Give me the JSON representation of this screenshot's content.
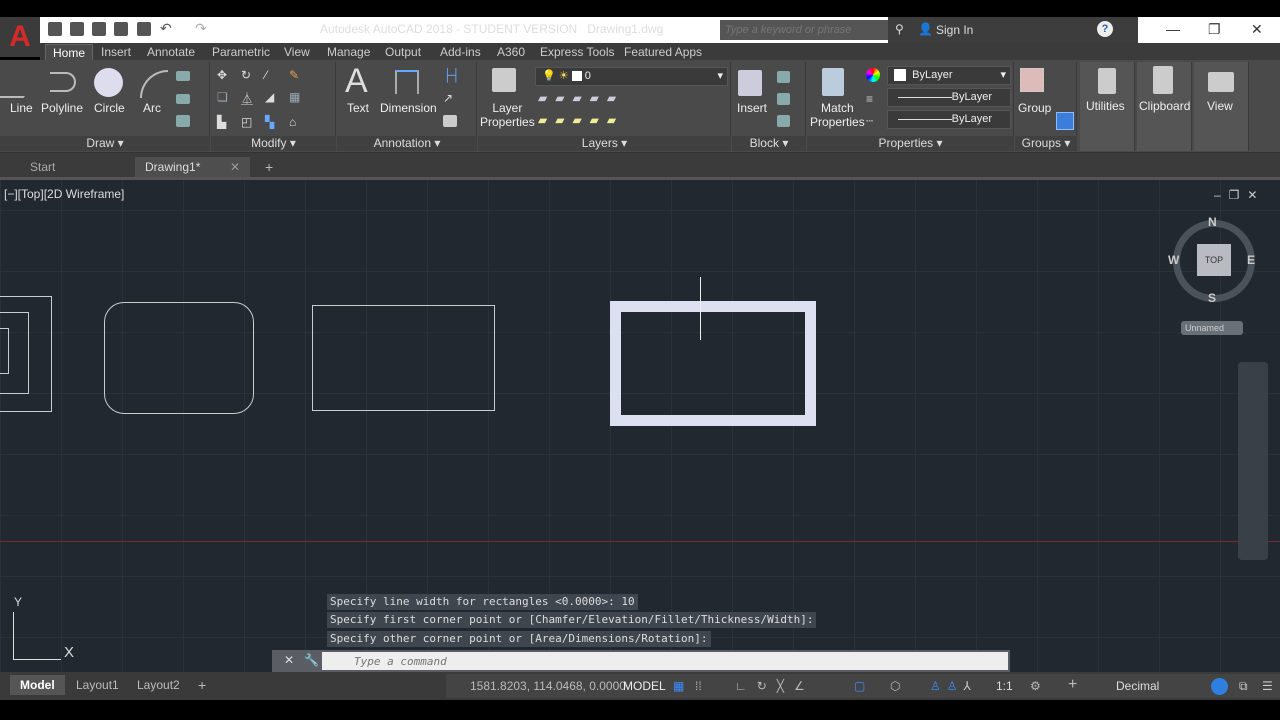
{
  "app": {
    "title": "Autodesk AutoCAD 2018 - STUDENT VERSION",
    "file": "Drawing1.dwg",
    "logo": "A"
  },
  "search": {
    "placeholder": "Type a keyword or phrase"
  },
  "account": {
    "sign_in": "Sign In"
  },
  "ribbon_tabs": [
    "Home",
    "Insert",
    "Annotate",
    "Parametric",
    "View",
    "Manage",
    "Output",
    "Add-ins",
    "A360",
    "Express Tools",
    "Featured Apps"
  ],
  "draw": {
    "title": "Draw",
    "line": "Line",
    "polyline": "Polyline",
    "circle": "Circle",
    "arc": "Arc"
  },
  "modify": {
    "title": "Modify"
  },
  "annotation": {
    "title": "Annotation",
    "text": "Text",
    "dimension": "Dimension"
  },
  "layers": {
    "title": "Layers",
    "layer_properties_1": "Layer",
    "layer_properties_2": "Properties",
    "current_layer": "0"
  },
  "block": {
    "title": "Block",
    "insert": "Insert"
  },
  "properties": {
    "title": "Properties",
    "match_1": "Match",
    "match_2": "Properties",
    "color": "ByLayer",
    "linetype": "ByLayer",
    "lineweight": "ByLayer"
  },
  "groups": {
    "title": "Groups",
    "group": "Group"
  },
  "utilities": "Utilities",
  "clipboard": "Clipboard",
  "view": "View",
  "file_tabs": {
    "start": "Start",
    "drawing": "Drawing1*"
  },
  "viewport": {
    "label": "[−][Top][2D Wireframe]",
    "compass": {
      "n": "N",
      "s": "S",
      "e": "E",
      "w": "W",
      "top": "TOP"
    },
    "ucs_name": "Unnamed",
    "ucs_x": "X",
    "ucs_y": "Y"
  },
  "command": {
    "history": [
      "Specify line width for rectangles <0.0000>: 10",
      "Specify first corner point or [Chamfer/Elevation/Fillet/Thickness/Width]:",
      "Specify other corner point or [Area/Dimensions/Rotation]:"
    ],
    "placeholder": "Type a command"
  },
  "layout_tabs": [
    "Model",
    "Layout1",
    "Layout2"
  ],
  "status": {
    "coords": "1581.8203, 114.0468, 0.0000",
    "model": "MODEL",
    "scale": "1:1",
    "units": "Decimal"
  }
}
